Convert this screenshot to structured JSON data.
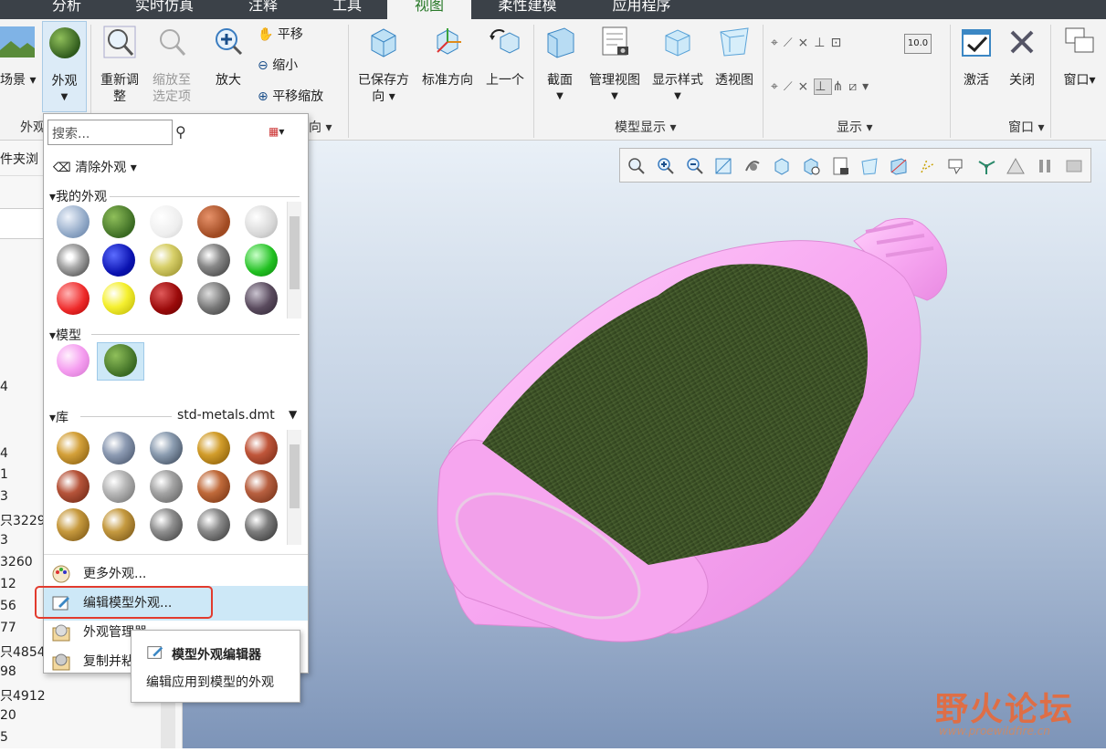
{
  "tabs": [
    {
      "label": "分析"
    },
    {
      "label": "实时仿真"
    },
    {
      "label": "注释"
    },
    {
      "label": "工具"
    },
    {
      "label": "视图"
    },
    {
      "label": "柔性建模"
    },
    {
      "label": "应用程序"
    }
  ],
  "ribbon": {
    "scene_label": "场景",
    "appearance_label": "外观",
    "regen_label": "重新调整",
    "zoom_sel_label": "缩放至选定项",
    "zoom_in_label": "放大",
    "pan_label": "平移",
    "zoom_out_label": "缩小",
    "pan_zoom_label": "平移缩放",
    "saved_dir_label": "已保存方向",
    "std_dir_label": "标准方向",
    "prev_label": "上一个",
    "section_label": "截面",
    "manage_view_label": "管理视图",
    "display_style_label": "显示样式",
    "perspective_label": "透视图",
    "activate_label": "激活",
    "close_label": "关闭",
    "window_label": "窗口",
    "group_appearance": "外观",
    "group_direction": "向",
    "group_model_display": "模型显示",
    "group_display": "显示",
    "group_window": "窗口",
    "coord_readout": "10.0"
  },
  "leftpanel": {
    "folder_browser": "件夹浏",
    "numbers": [
      "4",
      "4",
      "1",
      "3",
      "只3229",
      "3",
      "3260",
      "12",
      "56",
      "77",
      "只4854",
      "98",
      "只4912",
      "20",
      "5"
    ]
  },
  "dropdown": {
    "search_placeholder": "搜索...",
    "clear_label": "清除外观",
    "my_appearances": "我的外观",
    "model_section": "模型",
    "library_section": "库",
    "library_file": "std-metals.dmt",
    "more_appearances": "更多外观...",
    "edit_model_appearance": "编辑模型外观...",
    "appearance_manager": "外观管理器",
    "copy_paste": "复制并粘"
  },
  "tooltip": {
    "title": "模型外观编辑器",
    "desc": "编辑应用到模型的外观"
  },
  "watermark": {
    "name": "野火论坛",
    "url": "www.proewildfire.cn"
  },
  "colors": {
    "tab_active_text": "#2a7a2a",
    "model_pink": "#f5a8f0",
    "label_texture": "#3f5327",
    "highlight_border": "#e23b2e",
    "selected_bg": "#cde8f7"
  }
}
